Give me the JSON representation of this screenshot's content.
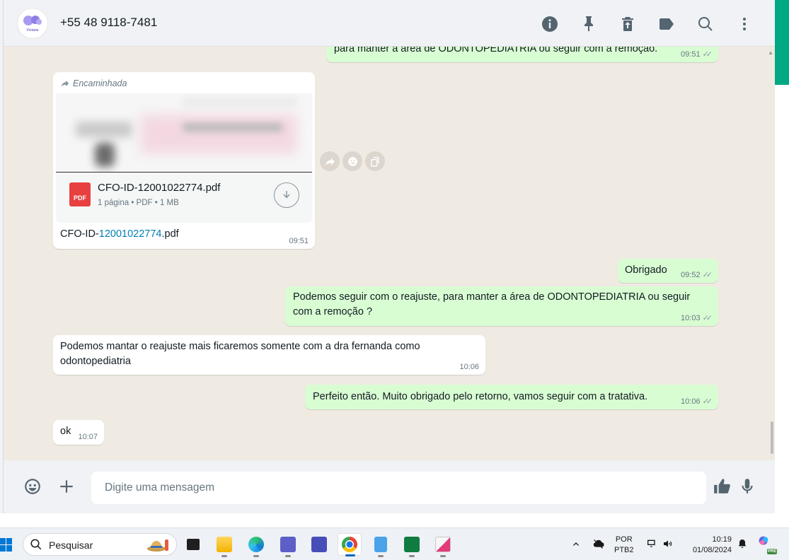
{
  "header": {
    "contact": "+55 48 9118-7481",
    "avatar_text": [
      "Clínica",
      "Viviane",
      "Marques"
    ]
  },
  "messages": {
    "m0": {
      "text": "para manter a área de ODONTOPEDIATRIA ou seguir com a remoção.",
      "time": "09:51"
    },
    "doc": {
      "forwarded_label": "Encaminhada",
      "file_name": "CFO-ID-12001022774.pdf",
      "file_meta": "1 página • PDF • 1 MB",
      "pdf_badge": "PDF",
      "caption_prefix": "CFO-ID-",
      "caption_link": "12001022774",
      "caption_suffix": ".pdf",
      "time": "09:51"
    },
    "m1": {
      "text": "Obrigado",
      "time": "09:52"
    },
    "m2": {
      "text": "Podemos seguir com o reajuste, para manter a área de ODONTOPEDIATRIA ou seguir com a remoção ?",
      "time": "10:03"
    },
    "m3": {
      "text": "Podemos mantar o reajuste mais ficaremos somente com a dra fernanda como odontopediatria",
      "time": "10:06"
    },
    "m4": {
      "text": "Perfeito então. Muito obrigado pelo retorno, vamos seguir com a tratativa.",
      "time": "10:06"
    },
    "m5": {
      "text": "ok",
      "time": "10:07"
    }
  },
  "composer": {
    "placeholder": "Digite uma mensagem"
  },
  "taskbar": {
    "search_label": "Pesquisar",
    "lang_line1": "POR",
    "lang_line2": "PTB2",
    "clock_time": "10:19",
    "clock_date": "01/08/2024",
    "copilot_badge": "PRE"
  },
  "colors": {
    "incoming_bubble": "#ffffff",
    "outgoing_bubble": "#d9fdd3",
    "accent": "#00a884",
    "link": "#027eb5"
  }
}
